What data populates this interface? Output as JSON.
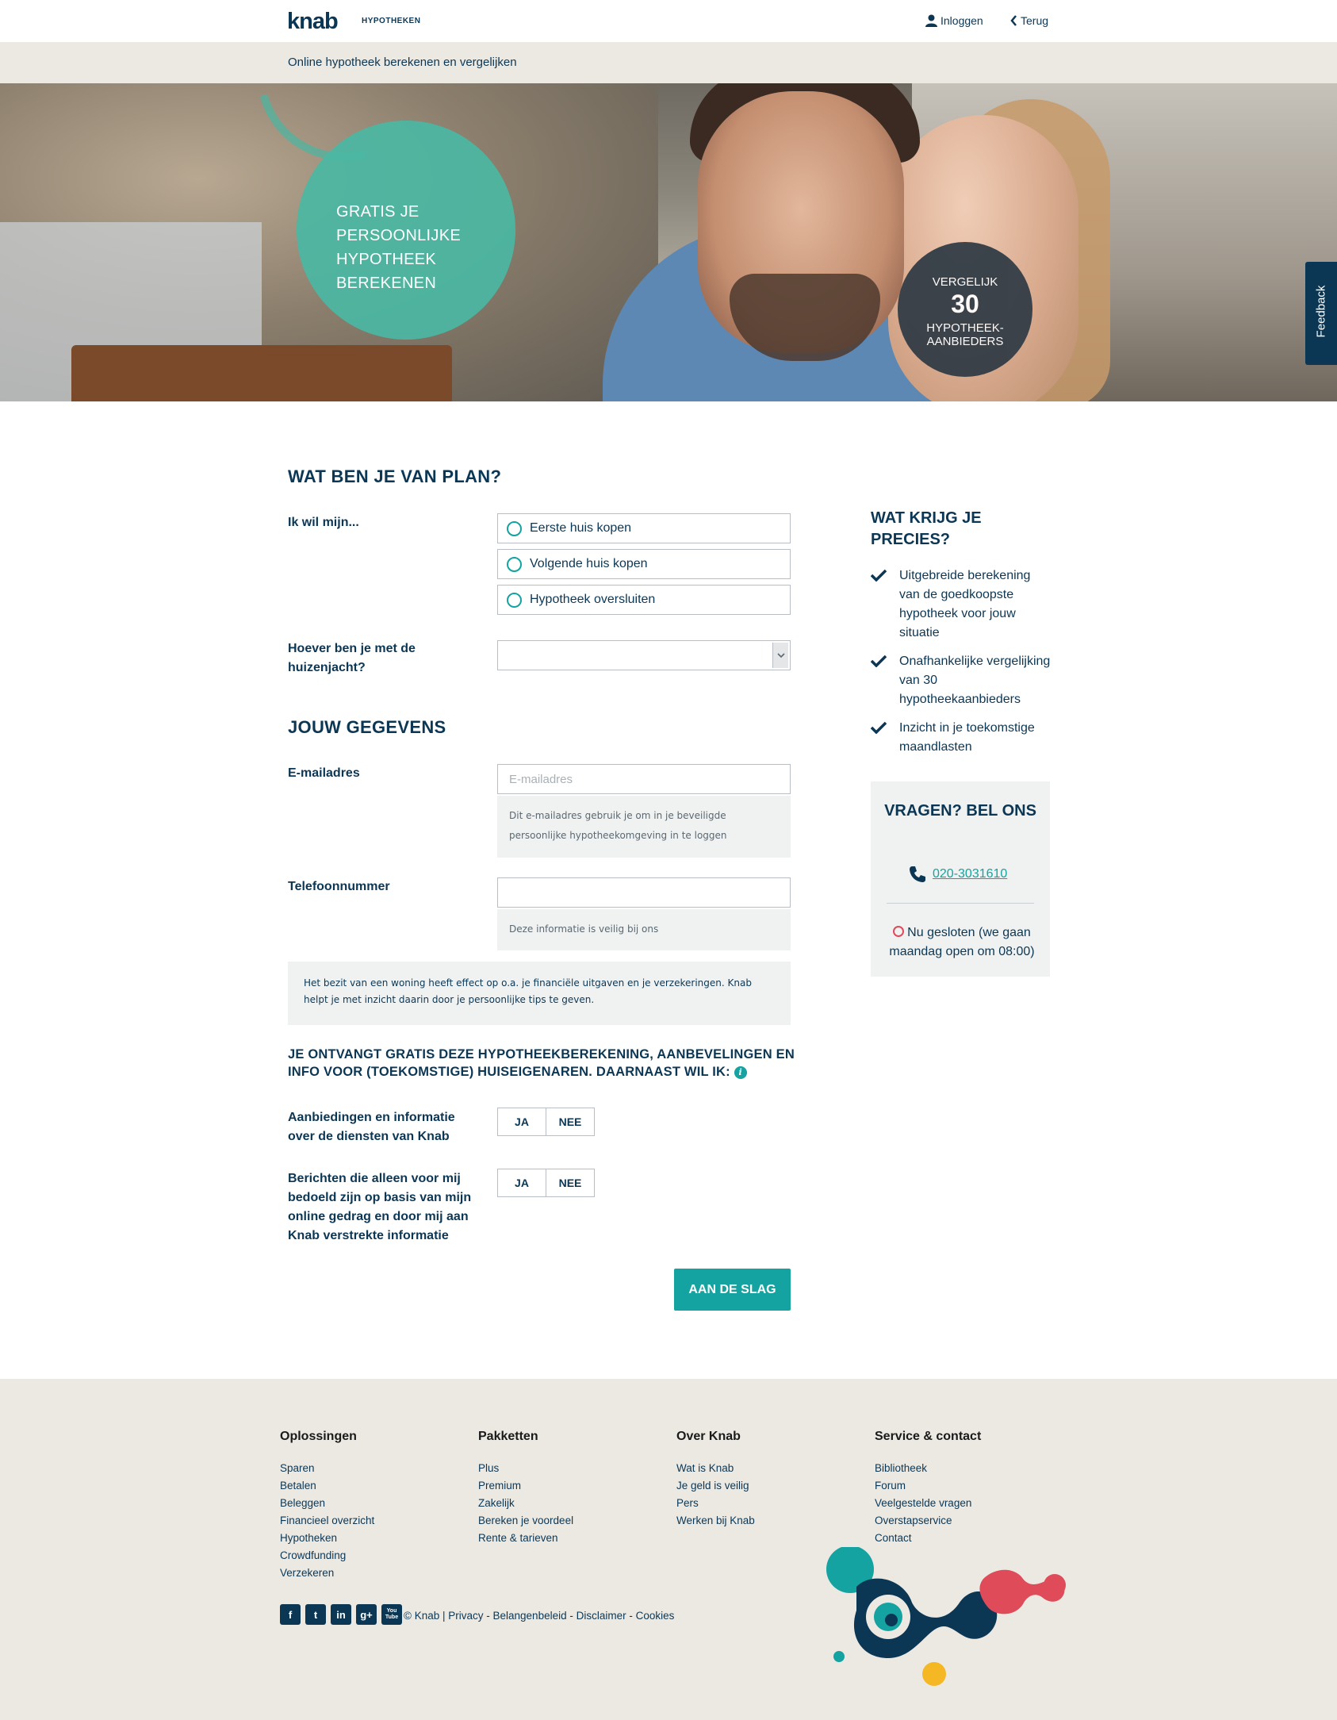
{
  "header": {
    "logo": "knab",
    "logo_sub": "HYPOTHEKEN",
    "login_label": "Inloggen",
    "back_label": "Terug"
  },
  "subheader": {
    "title": "Online hypotheek berekenen en vergelijken"
  },
  "hero": {
    "bubble_lines": [
      "GRATIS JE",
      "PERSOONLIJKE",
      "HYPOTHEEK",
      "BEREKENEN"
    ],
    "badge_top": "VERGELIJK",
    "badge_number": "30",
    "badge_bottom_1": "HYPOTHEEK-",
    "badge_bottom_2": "AANBIEDERS",
    "feedback_label": "Feedback"
  },
  "plan": {
    "heading": "WAT BEN JE VAN PLAN?",
    "question_label": "Ik wil mijn...",
    "options": [
      "Eerste huis kopen",
      "Volgende huis kopen",
      "Hypotheek oversluiten"
    ],
    "search_label_1": "Hoever ben je met de",
    "search_label_2": "huizenjacht?",
    "search_value": ""
  },
  "details": {
    "heading": "JOUW GEGEVENS",
    "email_label": "E-mailadres",
    "email_placeholder": "E-mailadres",
    "email_value": "",
    "email_hint": "Dit e-mailadres gebruik je om in je beveiligde persoonlijke hypotheekomgeving in te loggen",
    "phone_label": "Telefoonnummer",
    "phone_value": "",
    "phone_hint": "Deze informatie is veilig bij ons",
    "notice": "Het bezit van een woning heeft effect op o.a. je financiële uitgaven en je verzekeringen. Knab helpt je met inzicht daarin door je persoonlijke tips te geven."
  },
  "consent": {
    "heading": "JE ONTVANGT GRATIS DEZE HYPOTHEEKBEREKENING, AANBEVELINGEN EN INFO VOOR (TOEKOMSTIGE) HUISEIGENAREN. DAARNAAST WIL IK:",
    "info_icon": "i",
    "q1": "Aanbiedingen en informatie over de diensten van Knab",
    "q2": "Berichten die alleen voor mij bedoeld zijn op basis van mijn online gedrag en door mij aan Knab verstrekte informatie",
    "yes": "JA",
    "no": "NEE"
  },
  "cta_label": "AAN DE SLAG",
  "sidebar": {
    "title": "WAT KRIJG JE PRECIES?",
    "items": [
      "Uitgebreide berekening van de goedkoopste hypotheek voor jouw situatie",
      "Onafhankelijke vergelijking van 30 hypotheekaanbieders",
      "Inzicht in je toekomstige maandlasten"
    ],
    "call_title": "VRAGEN? BEL ONS",
    "phone": "020-3031610",
    "status": "Nu gesloten (we gaan maandag open om 08:00)"
  },
  "footer": {
    "columns": [
      {
        "title": "Oplossingen",
        "links": [
          "Sparen",
          "Betalen",
          "Beleggen",
          "Financieel overzicht",
          "Hypotheken",
          "Crowdfunding",
          "Verzekeren"
        ]
      },
      {
        "title": "Pakketten",
        "links": [
          "Plus",
          "Premium",
          "Zakelijk",
          "Bereken je voordeel",
          "Rente & tarieven"
        ]
      },
      {
        "title": "Over Knab",
        "links": [
          "Wat is Knab",
          "Je geld is veilig",
          "Pers",
          "Werken bij Knab"
        ]
      },
      {
        "title": "Service & contact",
        "links": [
          "Bibliotheek",
          "Forum",
          "Veelgestelde vragen",
          "Overstapservice",
          "Contact"
        ]
      }
    ],
    "social": [
      "f",
      "t",
      "in",
      "g+",
      "You Tube"
    ],
    "copyright": "© Knab",
    "legal": [
      "Privacy",
      "Belangenbeleid",
      "Disclaimer",
      "Cookies"
    ]
  },
  "colors": {
    "navy": "#0c3754",
    "teal": "#14a3a0",
    "beige": "#ece9e3",
    "red": "#e04b5a",
    "yellow": "#f5b824"
  }
}
